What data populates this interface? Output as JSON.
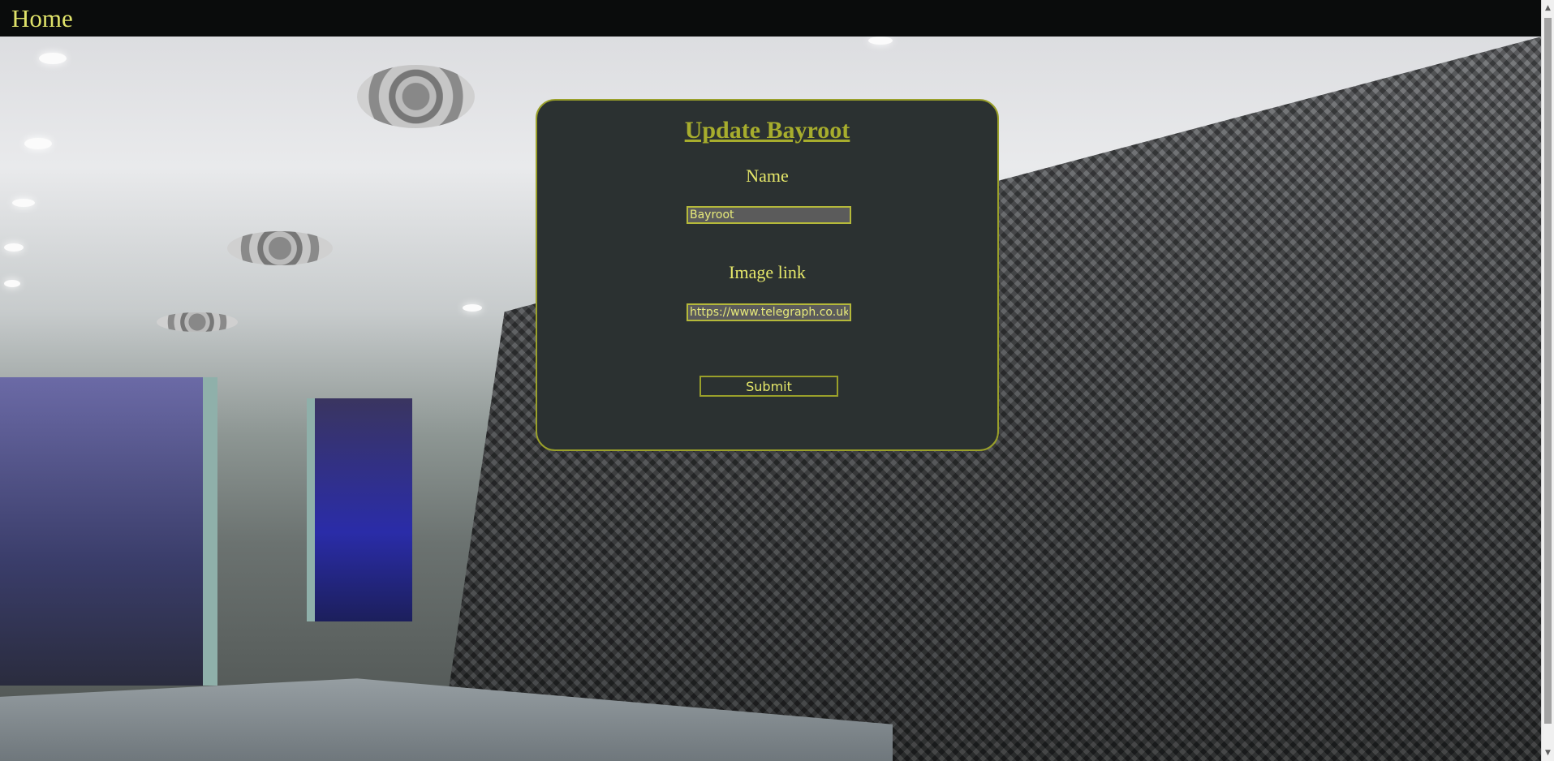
{
  "nav": {
    "home_label": "Home"
  },
  "form": {
    "title": "Update Bayroot",
    "name_label": "Name",
    "name_value": "Bayroot",
    "image_label": "Image link",
    "image_value": "https://www.telegraph.co.uk",
    "submit_label": "Submit"
  },
  "colors": {
    "accent": "#e6e86a",
    "title": "#a7ad2d",
    "card_bg": "#2b3131",
    "border": "#9aa02a",
    "input_bg": "#5b5b5b"
  },
  "icons": {
    "scroll_up": "scroll-up-arrow-icon",
    "scroll_down": "scroll-down-arrow-icon"
  }
}
